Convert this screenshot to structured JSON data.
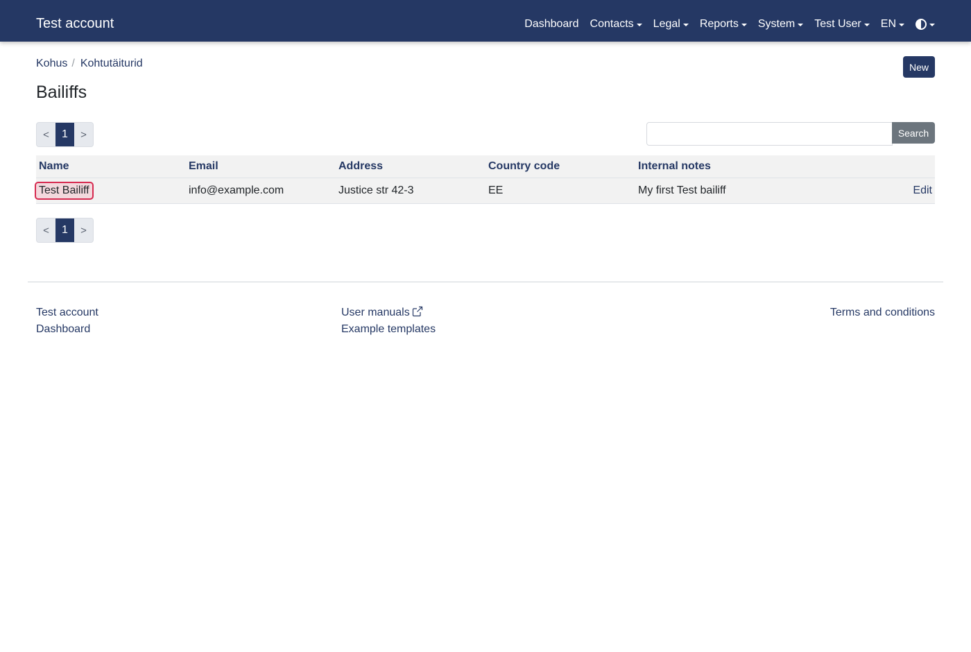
{
  "navbar": {
    "brand": "Test account",
    "items": [
      {
        "label": "Dashboard",
        "dropdown": false
      },
      {
        "label": "Contacts",
        "dropdown": true
      },
      {
        "label": "Legal",
        "dropdown": true
      },
      {
        "label": "Reports",
        "dropdown": true
      },
      {
        "label": "System",
        "dropdown": true
      },
      {
        "label": "Test User",
        "dropdown": true
      },
      {
        "label": "EN",
        "dropdown": true
      }
    ],
    "theme_icon": "contrast-icon",
    "color": "#253864"
  },
  "breadcrumb": [
    "Kohus",
    "Kohtutäiturid"
  ],
  "breadcrumb_separator": "/",
  "new_button": "New",
  "page_title": "Bailiffs",
  "pagination": {
    "prev": "<",
    "current": "1",
    "next": ">"
  },
  "search": {
    "value": "",
    "placeholder": "",
    "button": "Search"
  },
  "table": {
    "columns": [
      "Name",
      "Email",
      "Address",
      "Country code",
      "Internal notes"
    ],
    "rows": [
      {
        "name": "Test Bailiff",
        "email": "info@example.com",
        "address": "Justice str 42-3",
        "country_code": "EE",
        "notes": "My first Test bailiff",
        "action": "Edit"
      }
    ]
  },
  "footer": {
    "col1": [
      "Test account",
      "Dashboard"
    ],
    "col2": [
      "User manuals",
      "Example templates"
    ],
    "col3": [
      "Terms and conditions"
    ],
    "external_icon": "external-link-icon"
  }
}
